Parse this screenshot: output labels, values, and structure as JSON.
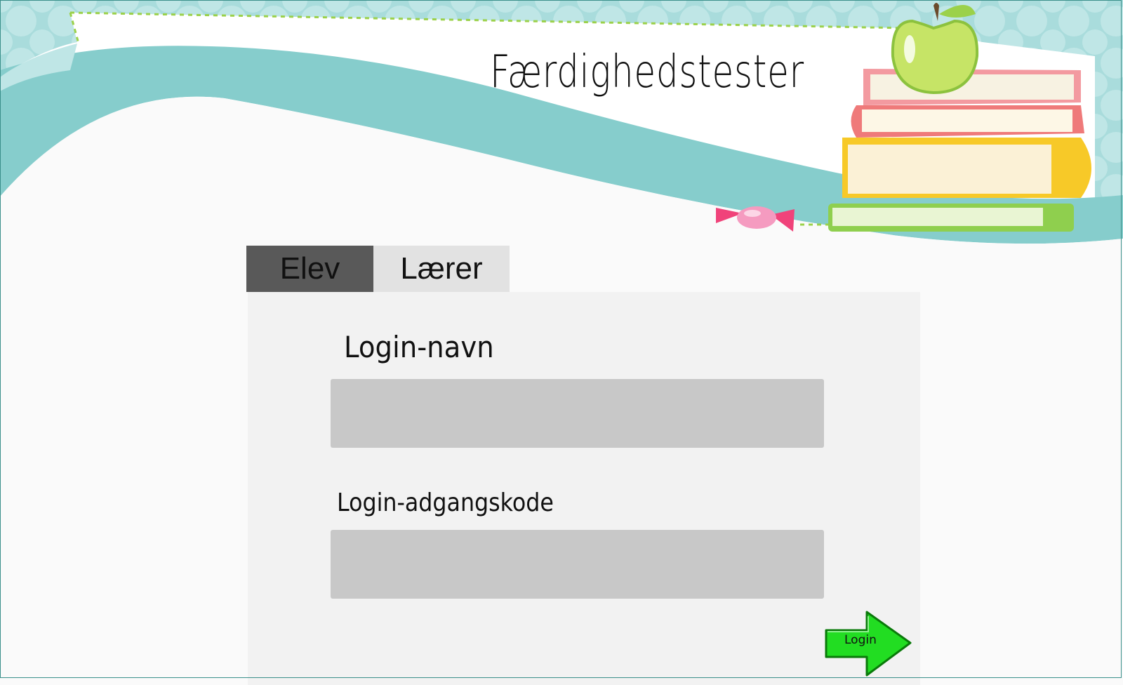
{
  "app": {
    "title": "Færdighedstester"
  },
  "tabs": [
    {
      "label": "Elev",
      "active": true
    },
    {
      "label": "Lærer",
      "active": false
    }
  ],
  "form": {
    "username_label": "Login-navn",
    "username_value": "",
    "password_label": "Login-adgangskode",
    "password_value": "",
    "submit_label": "Login"
  },
  "colors": {
    "teal": "#86cdcc",
    "tab_active": "#595959",
    "tab_inactive": "#e2e2e2",
    "panel": "#f2f2f2",
    "input": "#c8c8c8",
    "login_button": "#22dd22"
  },
  "icons": [
    "apple-icon",
    "books-icon",
    "candy-icon",
    "arrow-right-icon"
  ]
}
